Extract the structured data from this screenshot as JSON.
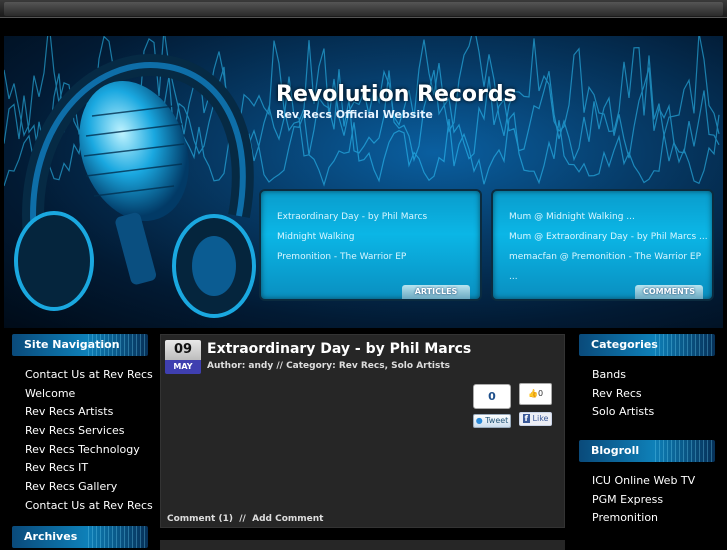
{
  "site": {
    "title": "Revolution Records",
    "subtitle": "Rev Recs Official Website"
  },
  "articles_panel": {
    "items": [
      "Extraordinary Day - by Phil Marcs",
      "Midnight Walking",
      "Premonition - The Warrior EP"
    ],
    "tab_label": "ARTICLES"
  },
  "comments_panel": {
    "items": [
      "Mum @ Midnight Walking ...",
      "Mum @ Extraordinary Day - by Phil Marcs ...",
      "memacfan @ Premonition - The Warrior EP ..."
    ],
    "tab_label": "COMMENTS"
  },
  "site_navigation": {
    "heading": "Site Navigation",
    "items": [
      "Contact Us at Rev Recs",
      "Welcome",
      "Rev Recs Artists",
      "Rev Recs Services",
      "Rev Recs Technology",
      "Rev Recs IT",
      "Rev Recs Gallery",
      "Contact Us at Rev Recs"
    ]
  },
  "archives": {
    "heading": "Archives"
  },
  "post": {
    "day": "09",
    "month": "MAY",
    "title": "Extraordinary Day - by Phil Marcs",
    "meta": "Author: andy  //  Category: Rev Recs, Solo Artists",
    "tweet_count": "0",
    "tweet_label": "Tweet",
    "like_count": "0",
    "like_label": "Like",
    "comments_link": "Comment (1)",
    "separator": "//",
    "add_comment_link": "Add Comment"
  },
  "categories": {
    "heading": "Categories",
    "items": [
      "Bands",
      "Rev Recs",
      "Solo Artists"
    ]
  },
  "blogroll": {
    "heading": "Blogroll",
    "items": [
      "ICU Online Web TV",
      "PGM Express",
      "Premonition"
    ]
  },
  "colors": {
    "accent": "#0bb6e6",
    "header_dark": "#021a33",
    "post_bg": "#262626",
    "date_month": "#3f3fb0"
  }
}
